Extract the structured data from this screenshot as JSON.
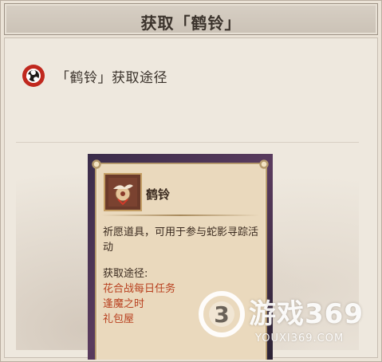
{
  "window": {
    "title": "获取「鹤铃」"
  },
  "section": {
    "heading": "「鹤铃」获取途径",
    "icon": "tomoe-emblem-icon"
  },
  "item_card": {
    "name": "鹤铃",
    "icon": "crane-bell-icon",
    "description": "祈愿道具，可用于参与蛇影寻踪活动",
    "methods_label": "获取途径:",
    "methods": [
      "花合战每日任务",
      "逢魔之时",
      "礼包屋"
    ]
  },
  "watermark": {
    "brand": "游戏369",
    "url": "YOUXI369.COM"
  },
  "colors": {
    "accent_red": "#b8401f",
    "emblem_red": "#c0281e",
    "panel_bg": "#ead9bd"
  }
}
